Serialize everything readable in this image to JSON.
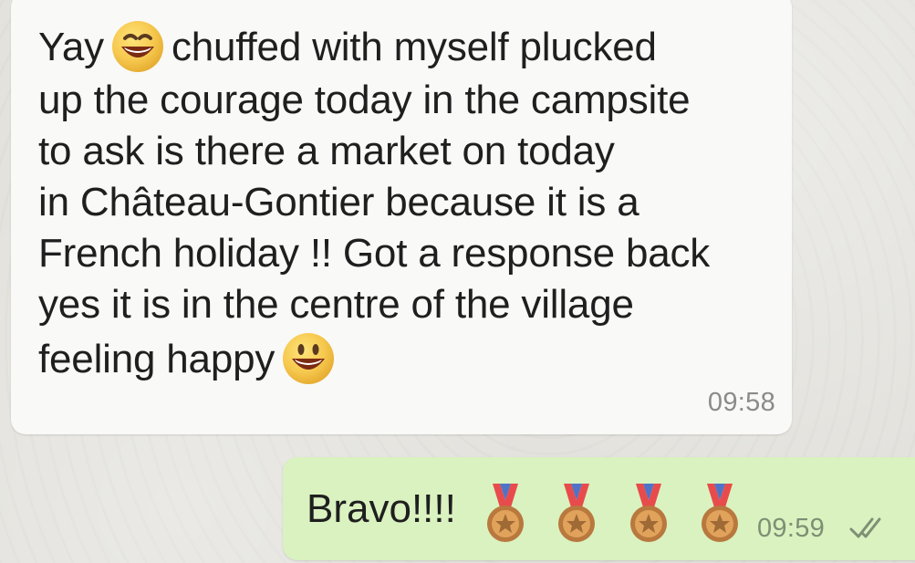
{
  "chat": {
    "incoming": {
      "lines": [
        {
          "before": "Yay",
          "after": "chuffed with myself plucked"
        },
        "up the courage today in the campsite",
        "to ask is there a market on today",
        "in Château-Gontier because it is a",
        "French holiday !! Got a response back",
        "yes it is in the centre of the village",
        {
          "before": "feeling happy"
        }
      ],
      "time": "09:58",
      "emoji": "grinning-face-with-smiling-eyes"
    },
    "outgoing": {
      "text": "Bravo!!!!",
      "emoji": "sports-medal",
      "emoji_count": 4,
      "time": "09:59",
      "status": "read"
    }
  },
  "colors": {
    "incoming_bubble": "#f9f9f8",
    "outgoing_bubble": "#d9f2c0",
    "wallpaper": "#e3e2dd",
    "meta_text": "#8b8b8b",
    "read_ticks": "#7d8f74"
  }
}
